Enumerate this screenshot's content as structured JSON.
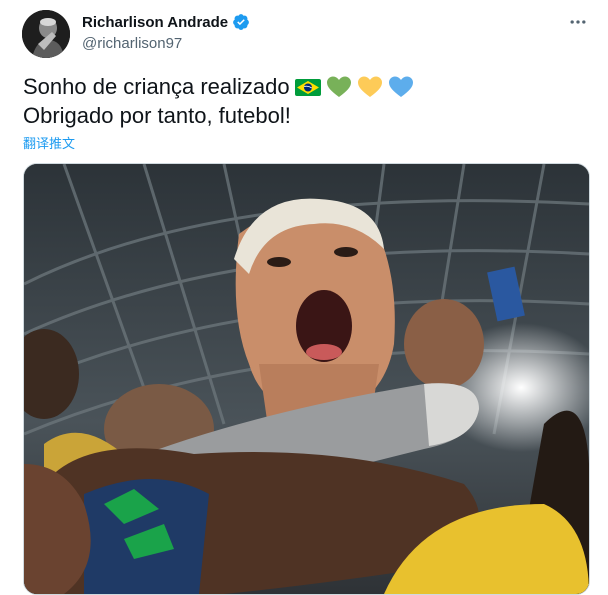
{
  "author": {
    "name": "Richarlison Andrade",
    "handle": "@richarlison97",
    "verified": true
  },
  "tweet": {
    "line1": "Sonho de criança realizado",
    "line2": "Obrigado por tanto, futebol!",
    "emojis": [
      "brazil-flag",
      "green-heart",
      "yellow-heart",
      "blue-heart"
    ],
    "translate_label": "翻译推文"
  },
  "media": {
    "description_icon": "photo"
  },
  "colors": {
    "link": "#1d9bf0",
    "verified": "#1d9bf0",
    "text": "#0f1419",
    "secondary": "#536471"
  }
}
